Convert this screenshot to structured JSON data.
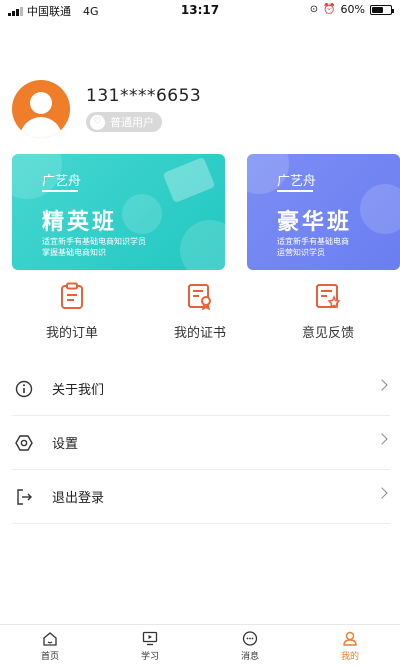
{
  "status_bar": {
    "carrier": "中国联通",
    "network": "4G",
    "time": "13:17",
    "battery": "60%",
    "battery_level": 0.6
  },
  "profile": {
    "phone": "131****6653",
    "badge": "普通用户"
  },
  "cards": [
    {
      "brand": "广艺舟",
      "title": "精英班",
      "desc_line1": "适宜新手有基础电商知识学员",
      "desc_line2": "掌握基础电商知识",
      "color": "#2ccac4"
    },
    {
      "brand": "广艺舟",
      "title": "豪华班",
      "desc_line1": "适宜新手有基础电商",
      "desc_line2": "运营知识学员",
      "color": "#6f82f2"
    }
  ],
  "quick_actions": [
    {
      "label": "我的订单",
      "icon": "clipboard-icon"
    },
    {
      "label": "我的证书",
      "icon": "certificate-icon"
    },
    {
      "label": "意见反馈",
      "icon": "feedback-icon"
    }
  ],
  "menu": [
    {
      "label": "关于我们",
      "icon": "info-icon"
    },
    {
      "label": "设置",
      "icon": "settings-icon"
    },
    {
      "label": "退出登录",
      "icon": "logout-icon"
    }
  ],
  "tabbar": [
    {
      "label": "首页",
      "icon": "home-icon",
      "active": false
    },
    {
      "label": "学习",
      "icon": "study-icon",
      "active": false
    },
    {
      "label": "消息",
      "icon": "message-icon",
      "active": false
    },
    {
      "label": "我的",
      "icon": "profile-icon",
      "active": true
    }
  ],
  "colors": {
    "accent": "#f07d2a",
    "icon_orange": "#e8613a",
    "text": "#333333"
  }
}
